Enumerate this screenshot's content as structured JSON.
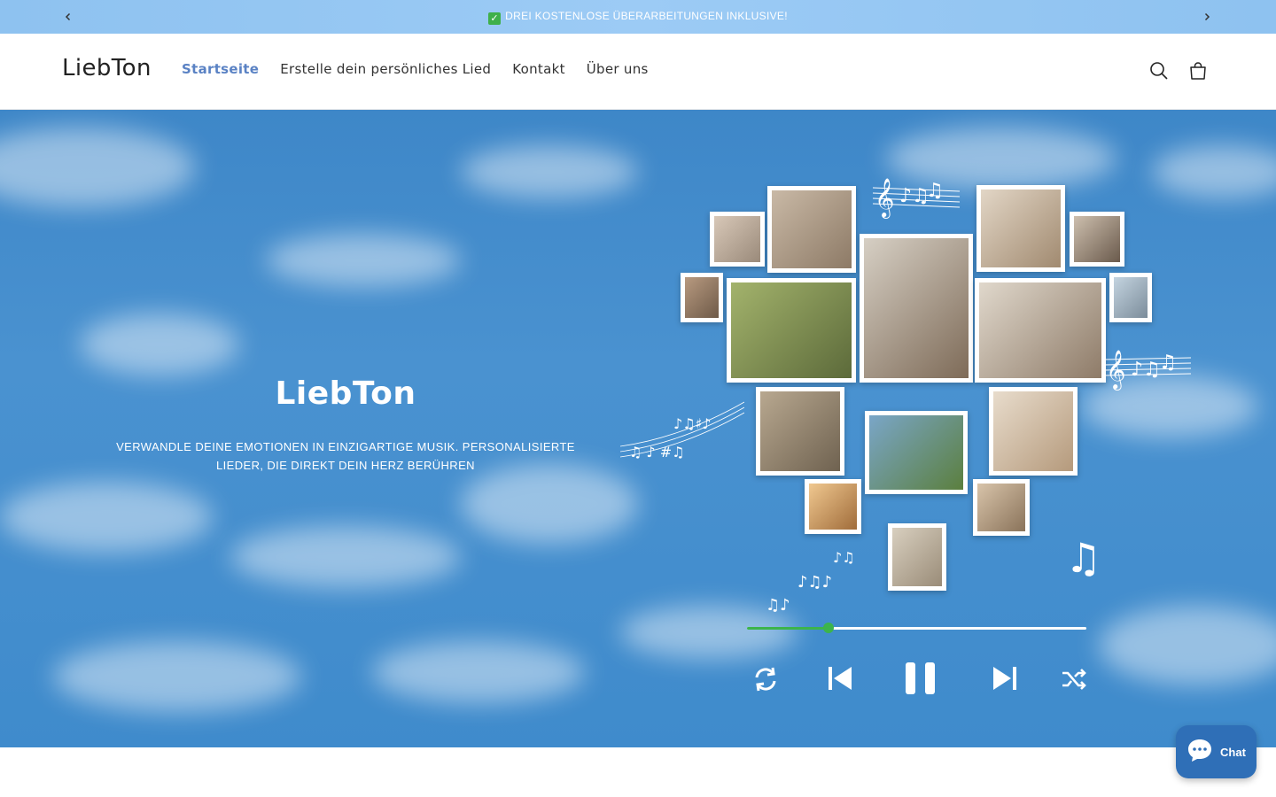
{
  "announcement": {
    "check_icon": "check-box-icon",
    "text": "DREI KOSTENLOSE ÜBERARBEITUNGEN INKLUSIVE!",
    "prev_icon": "chevron-left-icon",
    "next_icon": "chevron-right-icon"
  },
  "header": {
    "logo": "LiebTon",
    "nav": [
      {
        "label": "Startseite",
        "active": true
      },
      {
        "label": "Erstelle dein persönliches Lied",
        "active": false
      },
      {
        "label": "Kontakt",
        "active": false
      },
      {
        "label": "Über uns",
        "active": false
      }
    ],
    "search_icon": "search-icon",
    "cart_icon": "cart-icon"
  },
  "hero": {
    "title": "LiebTon",
    "subtitle": "VERWANDLE DEINE EMOTIONEN IN EINZIGARTIGE MUSIK. PERSONALISIERTE LIEDER, DIE DIREKT DEIN HERZ BERÜHREN",
    "player": {
      "progress": 0.24,
      "controls": [
        "repeat-icon",
        "previous-icon",
        "pause-icon",
        "next-icon",
        "shuffle-icon"
      ]
    },
    "colors": {
      "sky": "#4a92d0",
      "progress": "#3cb44b"
    }
  },
  "chat": {
    "label": "Chat",
    "icon": "chat-bubble-icon",
    "color": "#2f6fb7"
  }
}
